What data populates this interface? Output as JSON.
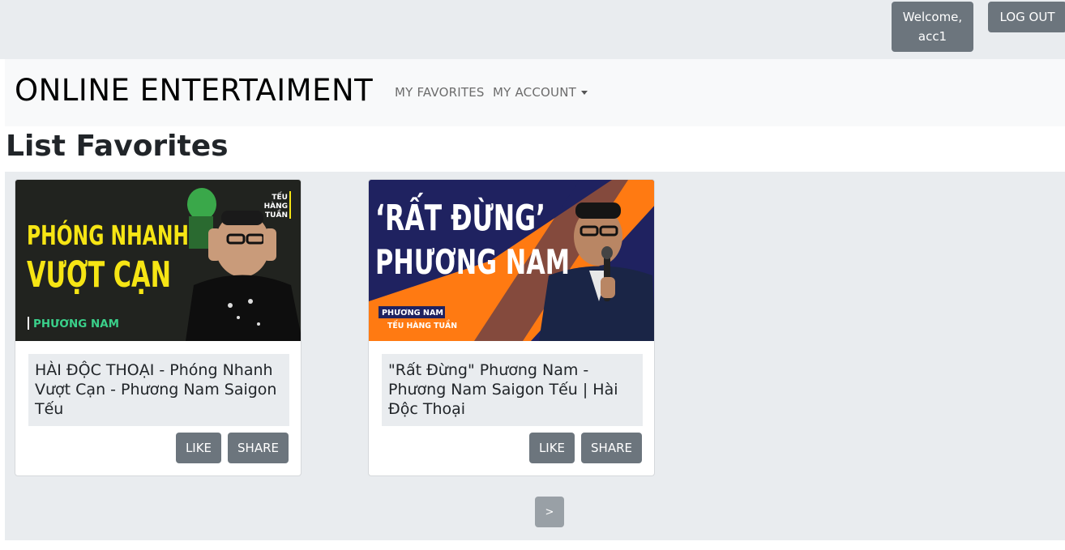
{
  "header": {
    "welcome_line1": "Welcome,",
    "welcome_line2": "acc1",
    "logout_label": "LOG OUT"
  },
  "navbar": {
    "brand": "ONLINE ENTERTAIMENT",
    "links": [
      "MY FAVORITES",
      "MY ACCOUNT"
    ]
  },
  "page": {
    "title": "List Favorites"
  },
  "videos": [
    {
      "title": "HÀI ĐỘC THOẠI - Phóng Nhanh Vượt Cạn - Phương Nam Saigon Tếu",
      "thumb_line1": "PHÓNG NHANH",
      "thumb_line2": "VƯỢT CẠN",
      "thumb_tag": "PHƯƠNG NAM",
      "thumb_corner": [
        "TẾU",
        "HÀNG",
        "TUẦN"
      ],
      "like_label": "LIKE",
      "share_label": "SHARE"
    },
    {
      "title": "\"Rất Đừng\" Phương Nam - Phương Nam Saigon Tếu | Hài Độc Thoại",
      "thumb_line1": "‘RẤT ĐỪNG’",
      "thumb_line2": "PHƯƠNG NAM",
      "thumb_tag1": "PHƯƠNG NAM",
      "thumb_tag2": "TẾU HÀNG TUẦN",
      "like_label": "LIKE",
      "share_label": "SHARE"
    }
  ],
  "pagination": {
    "next_label": ">"
  },
  "colors": {
    "button": "#6c757d",
    "topbar": "#e9ecef",
    "navbar": "#f8f9fa",
    "thumb1_bg": "#1b1d1a",
    "thumb1_text": "#f6e514",
    "thumb2_navy": "#1f2260",
    "thumb2_orange": "#ff7a12"
  }
}
